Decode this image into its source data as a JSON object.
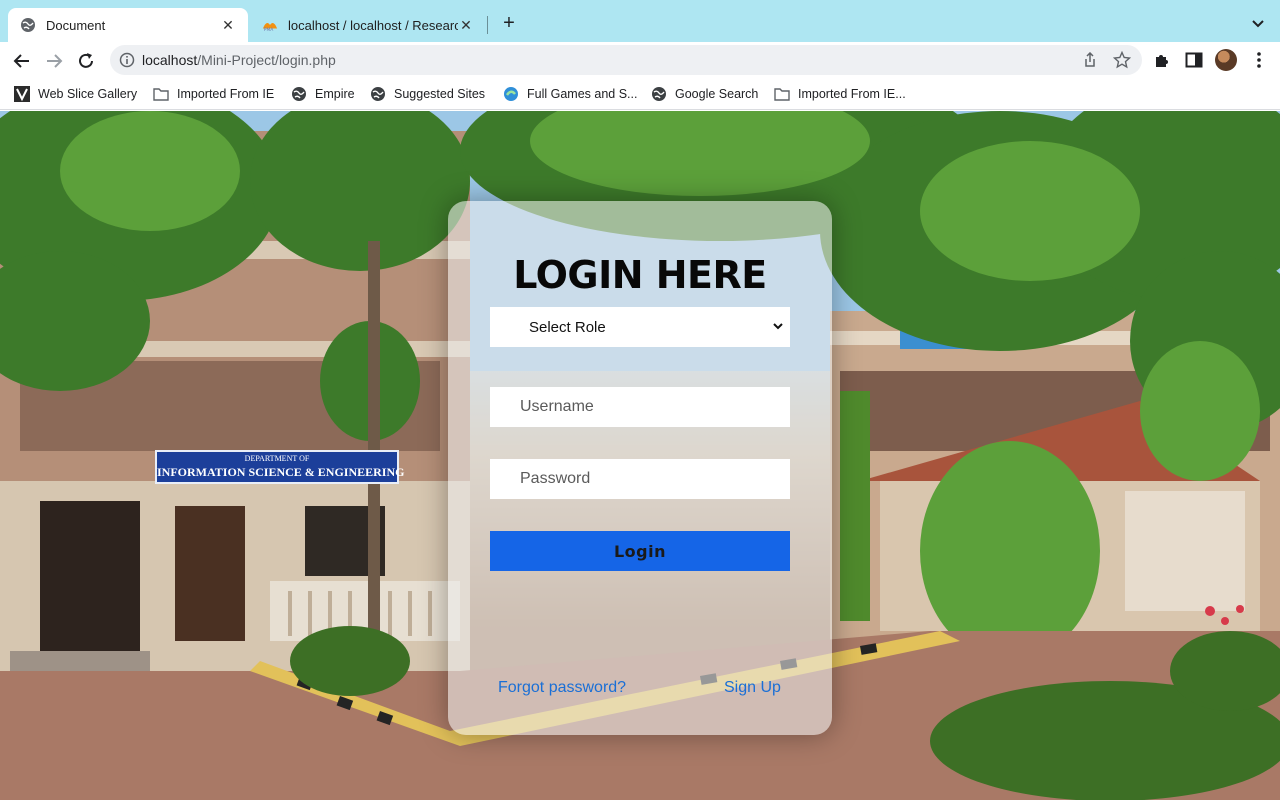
{
  "browser": {
    "tabs": [
      {
        "title": "Document",
        "active": true,
        "icon": "globe-icon"
      },
      {
        "title": "localhost / localhost / Research",
        "active": false,
        "icon": "phpmyadmin-icon"
      }
    ],
    "url": {
      "host": "localhost",
      "path": "/Mini-Project/login.php"
    },
    "bookmarks": [
      {
        "label": "Web Slice Gallery",
        "icon": "web-slice-icon"
      },
      {
        "label": "Imported From IE",
        "icon": "folder-icon"
      },
      {
        "label": "Empire",
        "icon": "globe-icon"
      },
      {
        "label": "Suggested Sites",
        "icon": "globe-icon"
      },
      {
        "label": "Full Games and S...",
        "icon": "edge-icon"
      },
      {
        "label": "Google Search",
        "icon": "globe-icon"
      },
      {
        "label": "Imported From IE...",
        "icon": "folder-icon"
      }
    ]
  },
  "background_sign": {
    "line1": "DEPARTMENT OF",
    "line2": "INFORMATION SCIENCE & ENGINEERING"
  },
  "login": {
    "title": "LOGIN HERE",
    "role_select": {
      "selected": "Select Role"
    },
    "username": {
      "placeholder": "Username",
      "value": ""
    },
    "password": {
      "placeholder": "Password",
      "value": ""
    },
    "submit_label": "Login",
    "forgot_label": "Forgot password?",
    "signup_label": "Sign Up"
  },
  "colors": {
    "tab_strip": "#aee6f2",
    "login_button": "#1565e7",
    "link": "#1a6fd6",
    "sign": "#1c3f9a"
  }
}
